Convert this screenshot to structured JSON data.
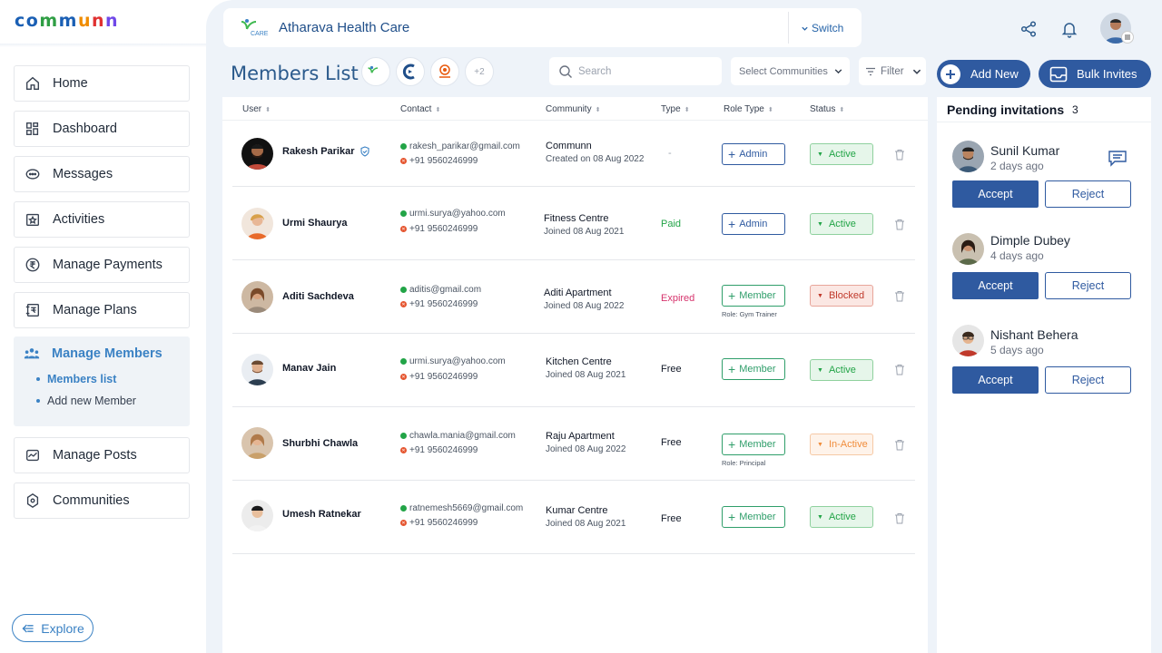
{
  "brand": {
    "letters": [
      "c",
      "o",
      "m",
      "m",
      "u",
      "n",
      "n"
    ],
    "colors": [
      "#1a5fb4",
      "#1a5fb4",
      "#2f9e44",
      "#1a5fb4",
      "#f08c00",
      "#e03131",
      "#7048e8"
    ]
  },
  "sidebar": {
    "items": [
      {
        "label": "Home",
        "icon": "home-icon"
      },
      {
        "label": "Dashboard",
        "icon": "dashboard-icon"
      },
      {
        "label": "Messages",
        "icon": "messages-icon"
      },
      {
        "label": "Activities",
        "icon": "activities-icon"
      },
      {
        "label": "Manage Payments",
        "icon": "rupee-icon"
      },
      {
        "label": "Manage Plans",
        "icon": "plans-icon"
      },
      {
        "label": "Manage Posts",
        "icon": "posts-icon"
      },
      {
        "label": "Communities",
        "icon": "communities-icon"
      }
    ],
    "active": {
      "label": "Manage Members",
      "subitems": [
        "Members list",
        "Add new Member"
      ]
    },
    "explore": "Explore"
  },
  "topbar": {
    "community_logo_text": "CARE",
    "community_name": "Atharava Health Care",
    "switch": "Switch"
  },
  "page": {
    "title": "Members List",
    "more_communities": "+2",
    "search_placeholder": "Search",
    "select_communities": "Select Communities",
    "filter": "Filter",
    "add_new": "Add New",
    "bulk_invites": "Bulk Invites"
  },
  "table": {
    "headers": [
      "User",
      "Contact",
      "Community",
      "Type",
      "Role Type",
      "Status"
    ],
    "rows": [
      {
        "name": "Rakesh Parikar",
        "verified": true,
        "email": "rakesh_parikar@gmail.com",
        "phone": "+91 9560246999",
        "community": "Communn",
        "date": "Created on 08 Aug 2022",
        "type": "-",
        "role": "Admin",
        "role_sub": "",
        "status": "Active"
      },
      {
        "name": "Urmi Shaurya",
        "verified": false,
        "email": "urmi.surya@yahoo.com",
        "phone": "+91 9560246999",
        "community": "Fitness Centre",
        "date": "Joined 08 Aug 2021",
        "type": "Paid",
        "role": "Admin",
        "role_sub": "",
        "status": "Active"
      },
      {
        "name": "Aditi Sachdeva",
        "verified": false,
        "email": "aditis@gmail.com",
        "phone": "+91 9560246999",
        "community": "Aditi Apartment",
        "date": "Joined 08 Aug 2022",
        "type": "Expired",
        "role": "Member",
        "role_sub": "Role: Gym Trainer",
        "status": "Blocked"
      },
      {
        "name": "Manav Jain",
        "verified": false,
        "email": "urmi.surya@yahoo.com",
        "phone": "+91 9560246999",
        "community": "Kitchen Centre",
        "date": "Joined 08 Aug 2021",
        "type": "Free",
        "role": "Member",
        "role_sub": "",
        "status": "Active"
      },
      {
        "name": "Shurbhi Chawla",
        "verified": false,
        "email": "chawla.mania@gmail.com",
        "phone": "+91 9560246999",
        "community": "Raju Apartment",
        "date": "Joined 08 Aug 2022",
        "type": "Free",
        "role": "Member",
        "role_sub": "Role: Principal",
        "status": "In-Active"
      },
      {
        "name": "Umesh Ratnekar",
        "verified": false,
        "email": "ratnemesh5669@gmail.com",
        "phone": "+91 9560246999",
        "community": "Kumar Centre",
        "date": "Joined 08 Aug 2021",
        "type": "Free",
        "role": "Member",
        "role_sub": "",
        "status": "Active"
      }
    ]
  },
  "pending": {
    "title": "Pending invitations",
    "count": "3",
    "accept": "Accept",
    "reject": "Reject",
    "items": [
      {
        "name": "Sunil Kumar",
        "ago": "2 days ago"
      },
      {
        "name": "Dimple Dubey",
        "ago": "4 days ago"
      },
      {
        "name": "Nishant Behera",
        "ago": "5 days ago"
      }
    ]
  },
  "colors": {
    "accent": "#2f5aa0",
    "link": "#3b82c4",
    "active_green": "#22a447",
    "blocked_red": "#d9534f",
    "inactive_orange": "#f08c3a"
  }
}
